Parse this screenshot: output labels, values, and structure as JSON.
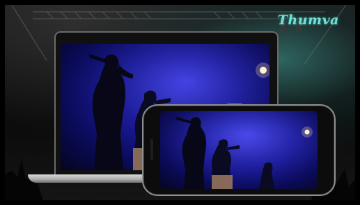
{
  "brand": {
    "logo_text": "Thumva",
    "logo_color": "#6fe3d7"
  },
  "scene": {
    "background_icons": [
      "stage-truss-icon",
      "crowd-hands-icon"
    ],
    "screen_icons": [
      "singer-silhouette-icon",
      "stage-light-icon"
    ],
    "colors": {
      "stage_blue": "#2a2ad0",
      "teal_glow": "#46aaa0",
      "device_frame": "#8f8f8f"
    }
  }
}
